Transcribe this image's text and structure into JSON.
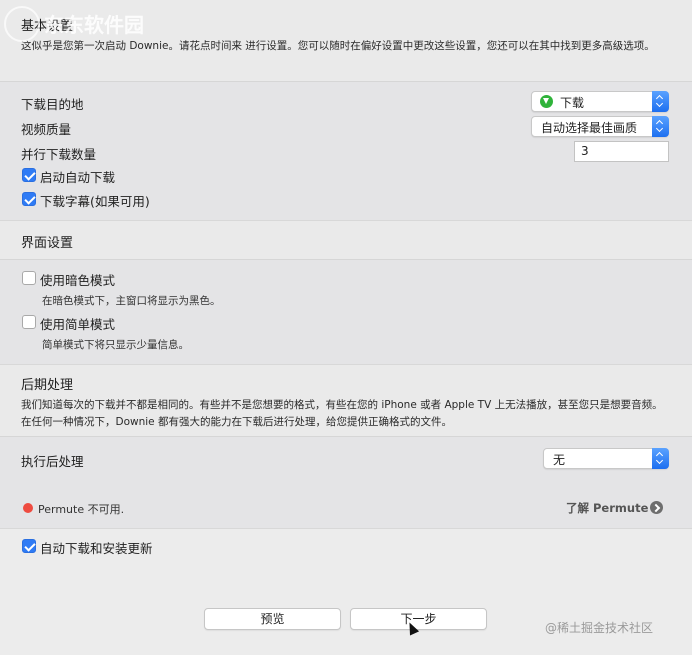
{
  "watermark": {
    "top_left": "东东软件园",
    "bottom_right": "@稀土掘金技术社区"
  },
  "basic": {
    "title": "基本设置",
    "description": "这似乎是您第一次启动 Downie。请花点时间来 进行设置。您可以随时在偏好设置中更改这些设置，您还可以在其中找到更多高级选项。",
    "destination_label": "下载目的地",
    "destination_value": "下载",
    "quality_label": "视频质量",
    "quality_value": "自动选择最佳画质",
    "parallel_label": "并行下载数量",
    "parallel_value": "3",
    "auto_download_label": "启动自动下载",
    "subtitles_label": "下载字幕(如果可用)"
  },
  "interface": {
    "title": "界面设置",
    "dark_mode_label": "使用暗色模式",
    "dark_mode_desc": "在暗色模式下，主窗口将显示为黑色。",
    "simple_mode_label": "使用简单模式",
    "simple_mode_desc": "简单模式下将只显示少量信息。"
  },
  "postprocess": {
    "title": "后期处理",
    "description": "我们知道每次的下载并不都是相同的。有些并不是您想要的格式，有些在您的 iPhone 或者 Apple TV 上无法播放，甚至您只是想要音频。在任何一种情况下，Downie 都有强大的能力在下载后进行处理，给您提供正确格式的文件。",
    "execute_label": "执行后处理",
    "execute_value": "无",
    "permute_status": "Permute 不可用.",
    "learn_permute": "了解 Permute"
  },
  "updates": {
    "auto_update_label": "自动下载和安装更新"
  },
  "buttons": {
    "preview": "预览",
    "next": "下一步"
  },
  "colors": {
    "accent": "#2f7bf5",
    "status_red": "#ee4b40",
    "download_green": "#2fb33a"
  }
}
